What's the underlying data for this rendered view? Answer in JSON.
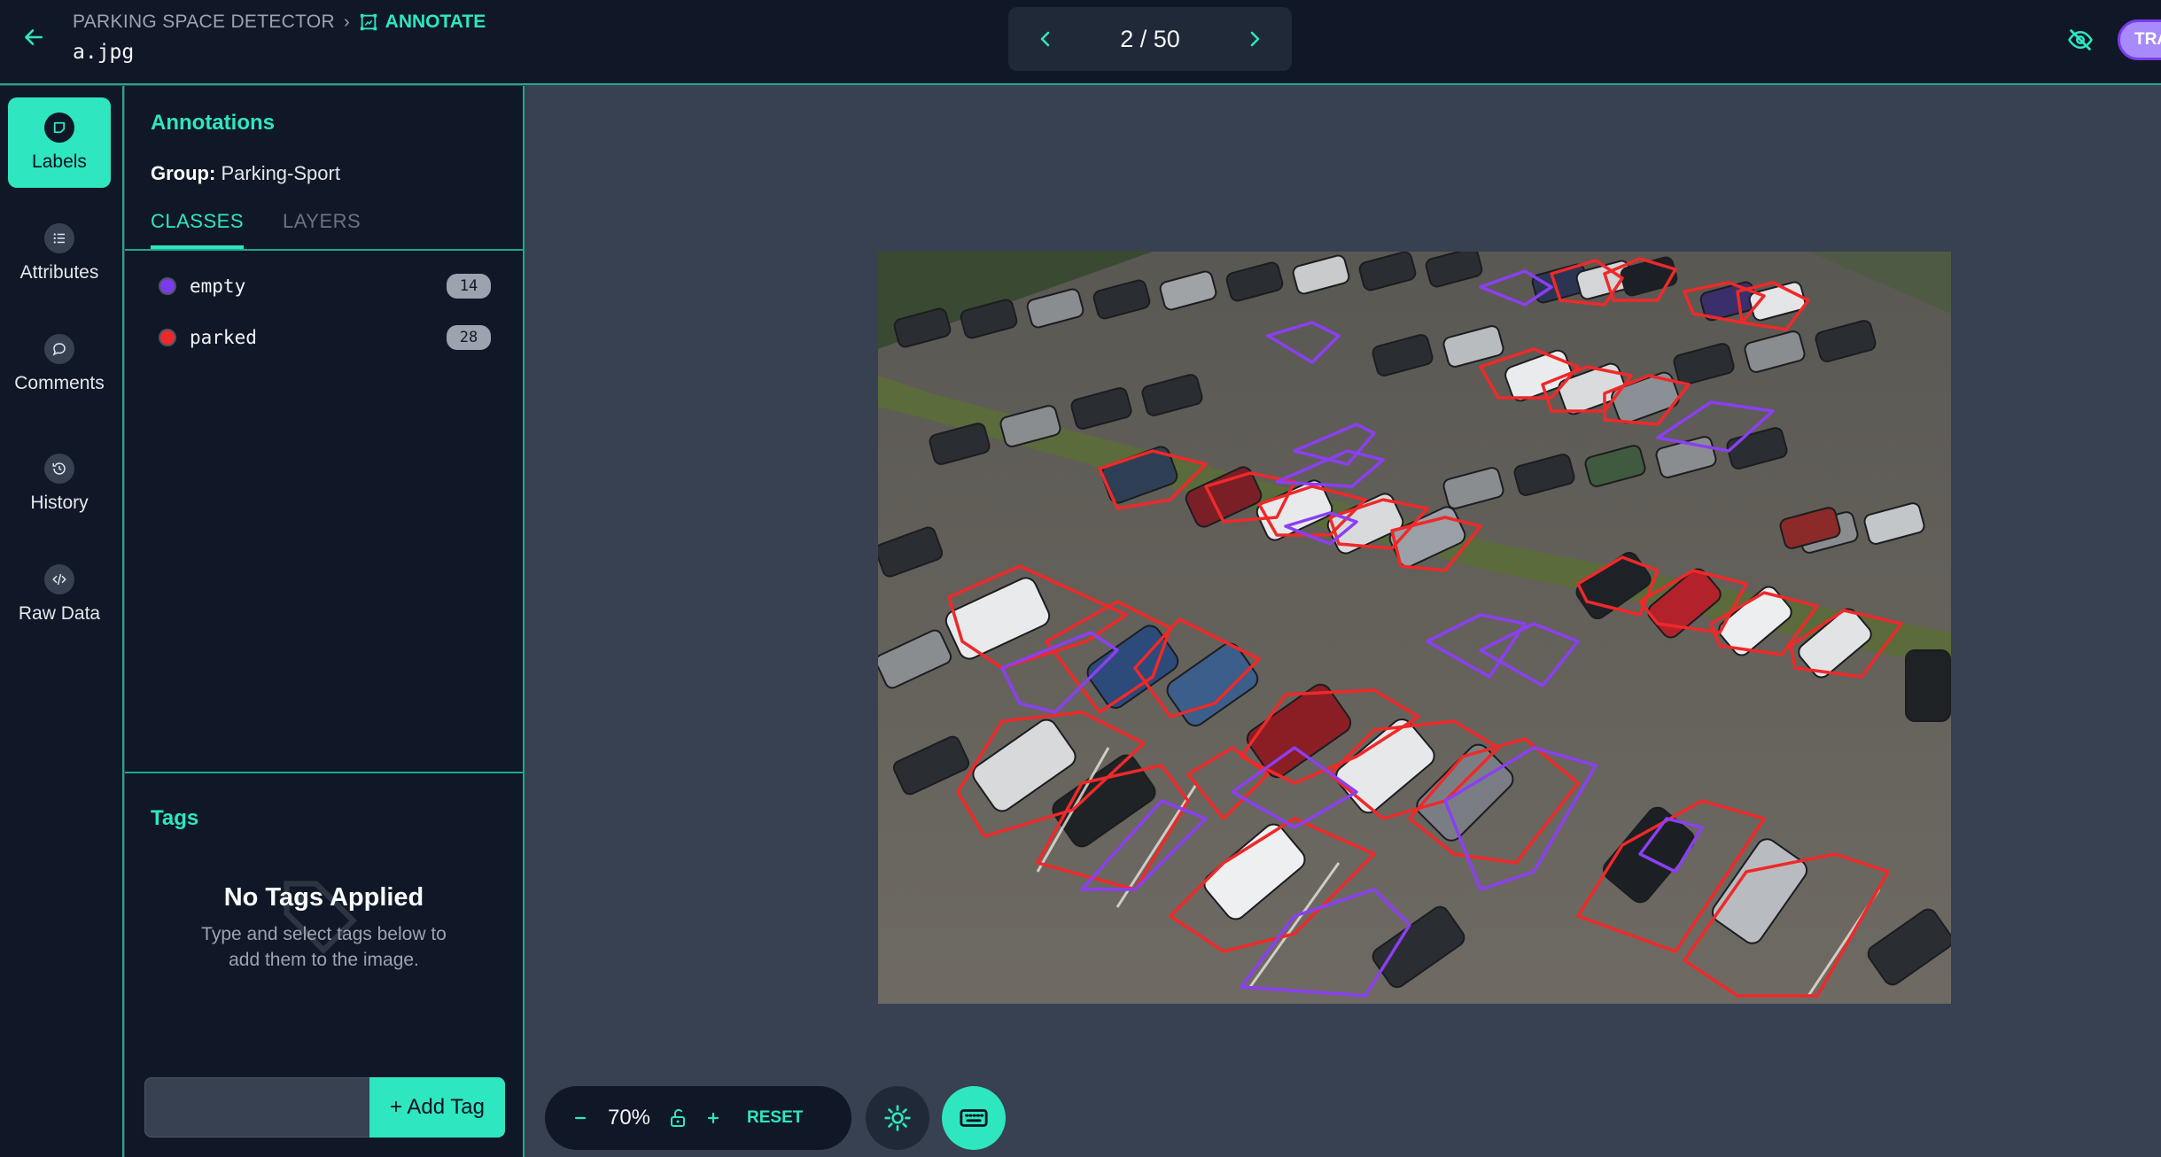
{
  "header": {
    "project": "PARKING SPACE DETECTOR",
    "mode": "ANNOTATE",
    "filename": "a.jpg",
    "pager": "2 / 50",
    "train_label": "TRAIN"
  },
  "sidenav": {
    "items": [
      {
        "label": "Labels",
        "icon": "label-icon"
      },
      {
        "label": "Attributes",
        "icon": "list-icon"
      },
      {
        "label": "Comments",
        "icon": "comment-icon"
      },
      {
        "label": "History",
        "icon": "history-icon"
      },
      {
        "label": "Raw Data",
        "icon": "code-icon"
      }
    ]
  },
  "panel": {
    "title": "Annotations",
    "group_label": "Group:",
    "group_value": "Parking-Sport",
    "tabs": [
      "CLASSES",
      "LAYERS"
    ],
    "classes": [
      {
        "name": "empty",
        "count": "14",
        "color": "#7c3aed"
      },
      {
        "name": "parked",
        "count": "28",
        "color": "#ef2929"
      }
    ]
  },
  "tags": {
    "title": "Tags",
    "empty_title": "No Tags Applied",
    "empty_desc_1": "Type and select tags below to",
    "empty_desc_2": "add them to the image.",
    "input_placeholder": "",
    "add_label": "+ Add Tag"
  },
  "toolbar": {
    "zoom": "70%",
    "reset_label": "RESET"
  },
  "colors": {
    "accent": "#2ee6c0",
    "empty": "#7c3aed",
    "parked": "#ef2929"
  }
}
